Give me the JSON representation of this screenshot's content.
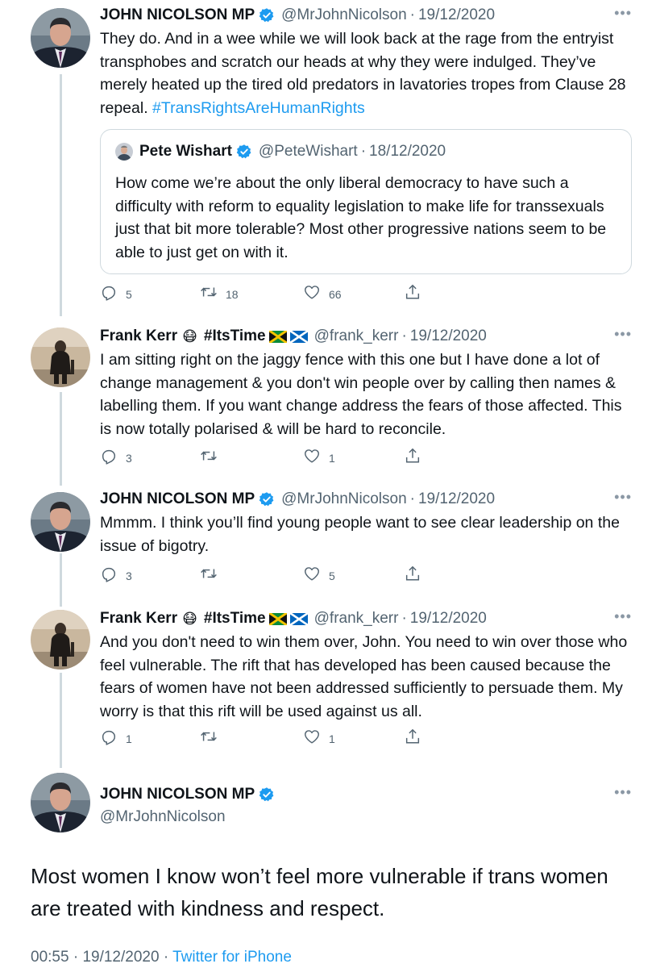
{
  "tweets": [
    {
      "name": "JOHN NICOLSON MP",
      "handle": "@MrJohnNicolson",
      "sep": "·",
      "date": "19/12/2020",
      "more": "•••",
      "text": "They do. And in a wee while we will look back at the rage from the entryist transphobes and scratch our heads at why they were indulged. They’ve merely heated up the tired old predators in lavatories tropes from Clause 28 repeal.",
      "hashtag": "#TransRightsAreHumanRights",
      "quote": {
        "name": "Pete Wishart",
        "handle": "@PeteWishart",
        "sep": "·",
        "date": "18/12/2020",
        "text": "How come we’re about the only liberal democracy to have such a difficulty with reform to equality legislation to make life for transsexuals just that bit more tolerable? Most other progressive nations seem to be able to just get on with it."
      },
      "replies": "5",
      "retweets": "18",
      "likes": "66"
    },
    {
      "name": "Frank Kerr",
      "emoji": "😷",
      "tag": "#ItsTime",
      "handle": "@frank_kerr",
      "sep": "·",
      "date": "19/12/2020",
      "more": "•••",
      "text": "I am sitting right on the jaggy fence with this one but I have done a lot of change management & you don't win people over by calling then names & labelling them. If you want change address the fears of those affected. This is now totally polarised & will be hard to reconcile.",
      "replies": "3",
      "retweets": "",
      "likes": "1"
    },
    {
      "name": "JOHN NICOLSON MP",
      "handle": "@MrJohnNicolson",
      "sep": "·",
      "date": "19/12/2020",
      "more": "•••",
      "text": "Mmmm. I think you’ll find young people want to see clear leadership on the issue of bigotry.",
      "replies": "3",
      "retweets": "",
      "likes": "5"
    },
    {
      "name": "Frank Kerr",
      "emoji": "😷",
      "tag": "#ItsTime",
      "handle": "@frank_kerr",
      "sep": "·",
      "date": "19/12/2020",
      "more": "•••",
      "text": "And you don't need to win them over, John. You need to win over those who feel vulnerable. The rift that has developed has been caused because the fears of women have not been addressed sufficiently to persuade them. My worry is that this rift will be used against us all.",
      "replies": "1",
      "retweets": "",
      "likes": "1"
    }
  ],
  "main_tweet": {
    "name": "JOHN NICOLSON MP",
    "handle": "@MrJohnNicolson",
    "more": "•••",
    "text": "Most women I know won’t feel more vulnerable if trans women are treated with kindness and respect.",
    "time": "00:55",
    "sep": "·",
    "date": "19/12/2020",
    "app": "Twitter for iPhone"
  },
  "colors": {
    "link": "#1d9bf0",
    "muted": "#536471",
    "verified": "#1d9bf0",
    "thread_line": "#cfd9de"
  },
  "icons": [
    "reply-icon",
    "retweet-icon",
    "like-icon",
    "share-icon",
    "verified-badge-icon",
    "more-icon"
  ]
}
